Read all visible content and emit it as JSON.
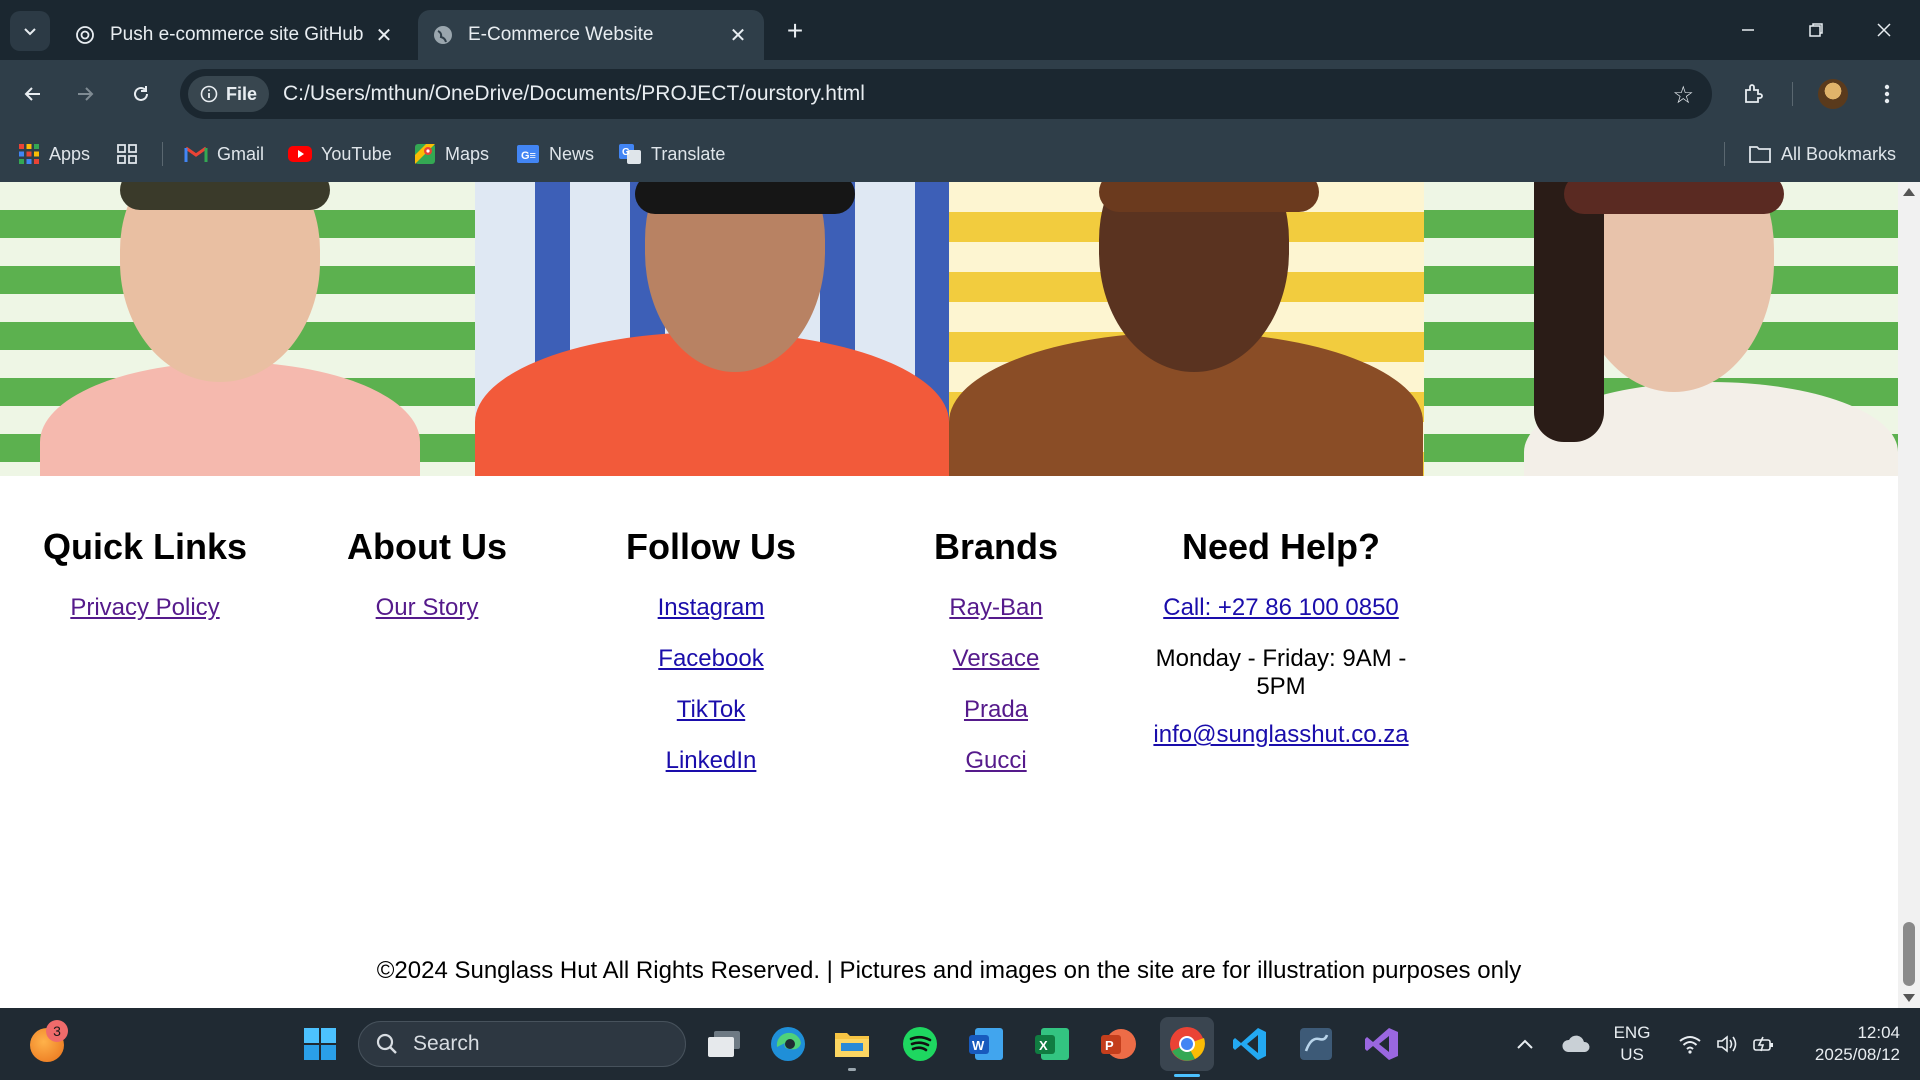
{
  "browser": {
    "tabs": [
      {
        "title": "Push e-commerce site GitHub",
        "icon": "chatgpt-icon"
      },
      {
        "title": "E-Commerce Website",
        "icon": "globe-icon"
      }
    ],
    "site_info_label": "File",
    "url": "C:/Users/mthun/OneDrive/Documents/PROJECT/ourstory.html",
    "bookmarks": [
      {
        "label": "Apps",
        "icon": "apps-grid-icon"
      },
      {
        "label": "Gmail",
        "icon": "gmail-icon"
      },
      {
        "label": "YouTube",
        "icon": "youtube-icon"
      },
      {
        "label": "Maps",
        "icon": "maps-icon"
      },
      {
        "label": "News",
        "icon": "news-icon"
      },
      {
        "label": "Translate",
        "icon": "translate-icon"
      }
    ],
    "all_bookmarks_label": "All Bookmarks"
  },
  "footer": {
    "quick_links": {
      "title": "Quick Links",
      "links": [
        "Privacy Policy"
      ]
    },
    "about_us": {
      "title": "About Us",
      "links": [
        "Our Story"
      ]
    },
    "follow_us": {
      "title": "Follow Us",
      "links": [
        "Instagram",
        "Facebook",
        "TikTok",
        "LinkedIn"
      ]
    },
    "brands": {
      "title": "Brands",
      "links": [
        "Ray-Ban",
        "Versace",
        "Prada",
        "Gucci"
      ]
    },
    "need_help": {
      "title": "Need Help?",
      "phone": "Call: +27 86 100 0850",
      "hours": "Monday - Friday: 9AM - 5PM",
      "email": "info@sunglasshut.co.za"
    },
    "copyright": "©2024 Sunglass Hut All Rights Reserved. | Pictures and images on the site are for illustration purposes only"
  },
  "taskbar": {
    "notification_count": "3",
    "search_placeholder": "Search",
    "language": "ENG",
    "region": "US",
    "time": "12:04",
    "date": "2025/08/12"
  }
}
